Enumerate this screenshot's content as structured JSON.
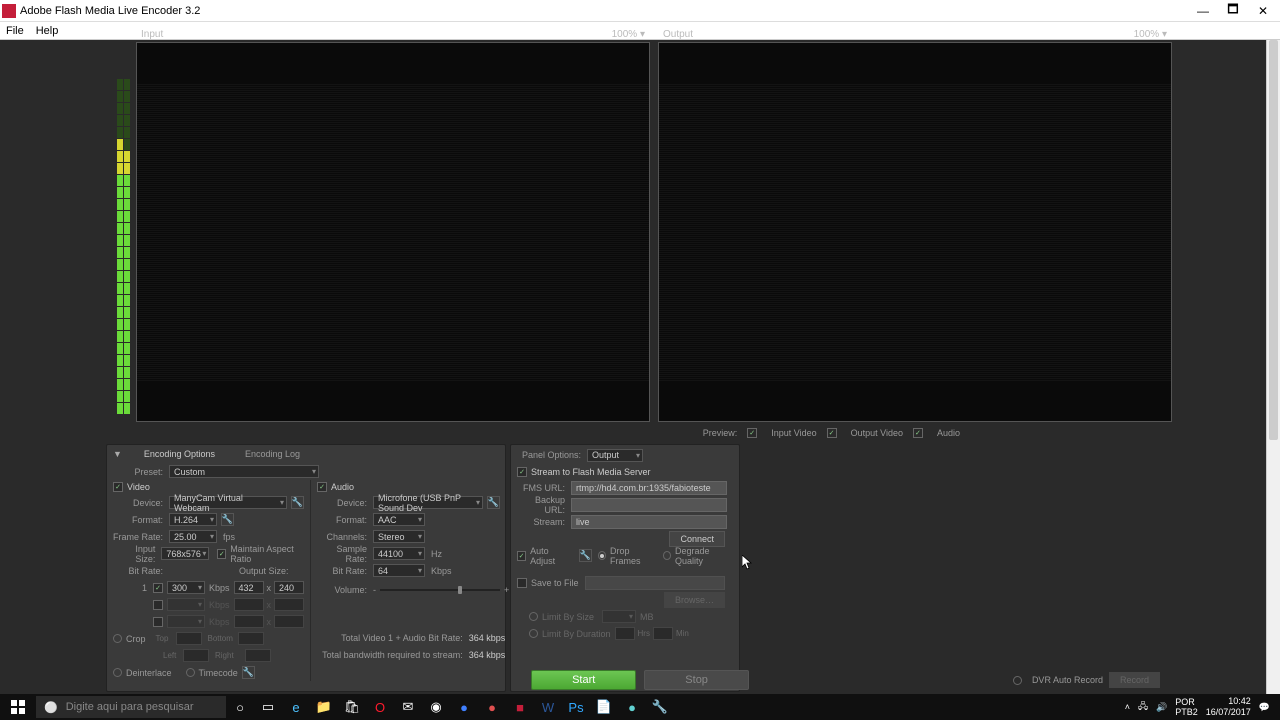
{
  "window": {
    "title": "Adobe Flash Media Live Encoder 3.2"
  },
  "menu": {
    "file": "File",
    "help": "Help"
  },
  "preview": {
    "input_label": "Input",
    "output_label": "Output",
    "input_zoom": "100%",
    "output_zoom": "100%",
    "options_label": "Preview:",
    "input_video": "Input Video",
    "output_video": "Output Video",
    "audio": "Audio"
  },
  "tabs": {
    "encoding": "Encoding Options",
    "log": "Encoding Log"
  },
  "preset": {
    "label": "Preset:",
    "value": "Custom"
  },
  "video": {
    "label": "Video",
    "device_label": "Device:",
    "device": "ManyCam Virtual Webcam",
    "format_label": "Format:",
    "format": "H.264",
    "framerate_label": "Frame Rate:",
    "framerate": "25.00",
    "fps": "fps",
    "inputsize_label": "Input Size:",
    "inputsize": "768x576",
    "maintain_aspect": "Maintain Aspect Ratio",
    "bitrate_label": "Bit Rate:",
    "outputsize_label": "Output Size:",
    "row1": {
      "idx": "1",
      "bitrate": "300",
      "kbps": "Kbps",
      "w": "432",
      "x": "x",
      "h": "240"
    },
    "crop_label": "Crop",
    "crop_top": "Top",
    "crop_bottom": "Bottom",
    "crop_left": "Left",
    "crop_right": "Right",
    "deinterlace": "Deinterlace",
    "timecode": "Timecode"
  },
  "audio": {
    "label": "Audio",
    "device_label": "Device:",
    "device": "Microfone (USB PnP Sound Dev",
    "format_label": "Format:",
    "format": "AAC",
    "channels_label": "Channels:",
    "channels": "Stereo",
    "samplerate_label": "Sample Rate:",
    "samplerate": "44100",
    "hz": "Hz",
    "bitrate_label": "Bit Rate:",
    "bitrate": "64",
    "kbps": "Kbps",
    "volume_label": "Volume:",
    "volume_minus": "-",
    "volume_plus": "+"
  },
  "bandwidth": {
    "line1_label": "Total Video 1 + Audio Bit Rate:",
    "line1_val": "364 kbps",
    "line2_label": "Total bandwidth required to stream:",
    "line2_val": "364 kbps"
  },
  "output": {
    "panel_label": "Panel Options:",
    "panel_value": "Output",
    "stream_to": "Stream to Flash Media Server",
    "fms_url_label": "FMS URL:",
    "fms_url": "rtmp://hd4.com.br:1935/fabioteste",
    "backup_url_label": "Backup URL:",
    "backup_url": "",
    "stream_label": "Stream:",
    "stream": "live",
    "connect": "Connect",
    "auto_adjust": "Auto Adjust",
    "drop_frames": "Drop Frames",
    "degrade_quality": "Degrade Quality",
    "save_to_file": "Save to File",
    "browse": "Browse…",
    "limit_size": "Limit By Size",
    "limit_size_unit": "MB",
    "limit_duration": "Limit By Duration",
    "limit_hrs": "Hrs",
    "limit_min": "Min"
  },
  "controls": {
    "start": "Start",
    "stop": "Stop",
    "dvr": "DVR Auto Record",
    "record": "Record"
  },
  "taskbar": {
    "search_placeholder": "Digite aqui para pesquisar",
    "time": "10:42",
    "date": "16/07/2017"
  }
}
